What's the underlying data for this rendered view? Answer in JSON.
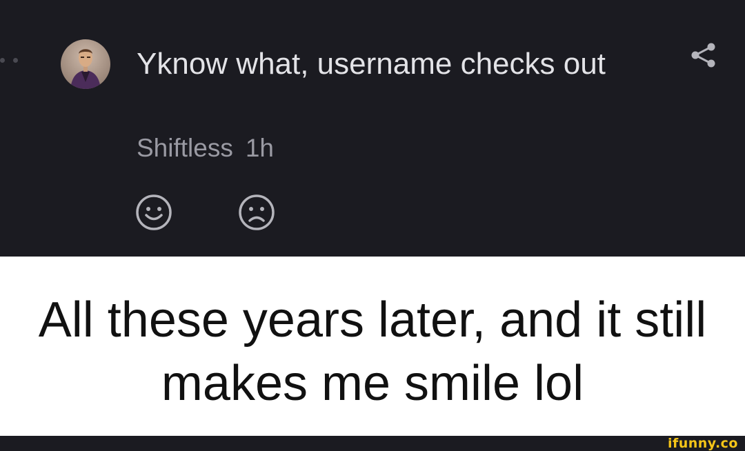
{
  "comment": {
    "text": "Yknow what, username checks out",
    "author": "Shiftless",
    "time": "1h"
  },
  "reactions": {
    "like_icon": "smiley-face-icon",
    "dislike_icon": "frowning-face-icon"
  },
  "actions": {
    "share_icon": "share-icon"
  },
  "caption": {
    "text": "All these years later, and it still makes me smile lol"
  },
  "watermark": {
    "text": "ifunny.co"
  },
  "colors": {
    "dark_background": "#1b1b21",
    "comment_text": "#e3e3e7",
    "meta_text": "#9a9aa3",
    "icon": "#b4b4bb",
    "caption_background": "#ffffff",
    "caption_text": "#111111",
    "watermark": "#f5c518"
  }
}
